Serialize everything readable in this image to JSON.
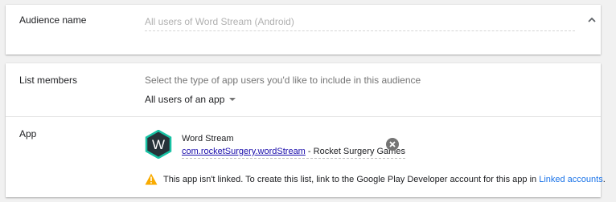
{
  "audience": {
    "label": "Audience name",
    "placeholder": "All users of Word Stream (Android)",
    "collapse_icon": "chevron-up-icon"
  },
  "list_members": {
    "label": "List members",
    "help_text": "Select the type of app users you'd like to include in this audience",
    "selected_option": "All users of an app",
    "dropdown_icon": "dropdown-arrow-icon"
  },
  "app": {
    "label": "App",
    "icon_letter": "W",
    "name": "Word Stream",
    "package": "com.rocketSurgery.wordStream",
    "separator": " - ",
    "developer": "Rocket Surgery Games",
    "remove_icon": "close-circle-icon"
  },
  "warning": {
    "icon": "warning-icon",
    "text": "This app isn't linked. To create this list, link to the Google Play Developer account for this app in ",
    "link_text": "Linked accounts",
    "end": "."
  },
  "colors": {
    "link": "#1a0dab",
    "accent_link": "#1a73e8",
    "warning": "#f9ab00",
    "app_icon_bg": "#263238",
    "app_icon_border": "#18c2a4"
  }
}
